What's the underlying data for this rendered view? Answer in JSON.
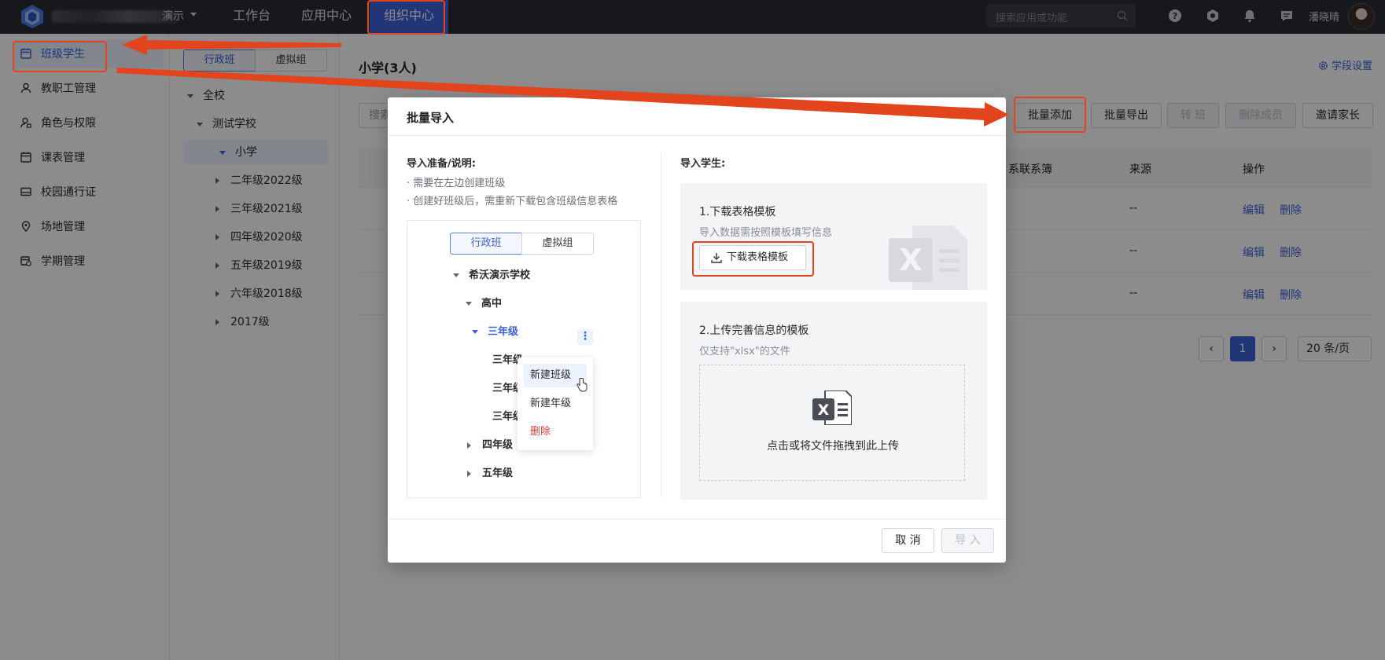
{
  "topbar": {
    "org_suffix": "演示",
    "nav": [
      "工作台",
      "应用中心",
      "组织中心"
    ],
    "search_placeholder": "搜索应用或功能",
    "user_name": "潘晓晴"
  },
  "sidebar": {
    "items": [
      "班级学生",
      "教职工管理",
      "角色与权限",
      "课表管理",
      "校园通行证",
      "场地管理",
      "学期管理"
    ]
  },
  "tree": {
    "seg": [
      "行政班",
      "虚拟组"
    ],
    "root": "全校",
    "school": "测试学校",
    "primary": "小学",
    "grades": [
      "二年级2022级",
      "三年级2021级",
      "四年级2020级",
      "五年级2019级",
      "六年级2018级",
      "2017级"
    ]
  },
  "main": {
    "title": "小学(3人)",
    "settings": "学段设置",
    "search_stub": "搜索",
    "buttons": [
      "批量添加",
      "批量导出",
      "转 班",
      "删除成员",
      "邀请家长"
    ],
    "columns": [
      "系联系簿",
      "来源",
      "操作"
    ],
    "rows": [
      {
        "source": "--",
        "edit": "编辑",
        "del": "删除"
      },
      {
        "source": "--",
        "edit": "编辑",
        "del": "删除"
      },
      {
        "source": "--",
        "edit": "编辑",
        "del": "删除"
      }
    ],
    "page": "1",
    "page_size": "20 条/页"
  },
  "modal": {
    "title": "批量导入",
    "prep_label": "导入准备/说明:",
    "notes": [
      "· 需要在左边创建班级",
      "· 创建好班级后，需重新下载包含班级信息表格"
    ],
    "preview": {
      "seg": [
        "行政班",
        "虚拟组"
      ],
      "school": "希沃演示学校",
      "high": "高中",
      "grade3": "三年级",
      "classes": [
        "三年级",
        "三年级",
        "三年级"
      ],
      "grade4": "四年级",
      "grade5": "五年级",
      "menu": [
        "新建班级",
        "新建年级",
        "删除"
      ]
    },
    "import_label": "导入学生:",
    "step1_title": "1.下载表格模板",
    "step1_sub": "导入数据需按照模板填写信息",
    "download_btn": "下载表格模板",
    "step2_title": "2.上传完善信息的模板",
    "step2_sub": "仅支持\"xlsx\"的文件",
    "drop_text": "点击或将文件拖拽到此上传",
    "cancel": "取 消",
    "import": "导 入"
  },
  "colors": {
    "accent": "#3c62d9",
    "annotation": "#e2441e",
    "topbar": "#2b2d33",
    "danger": "#e0403a"
  }
}
